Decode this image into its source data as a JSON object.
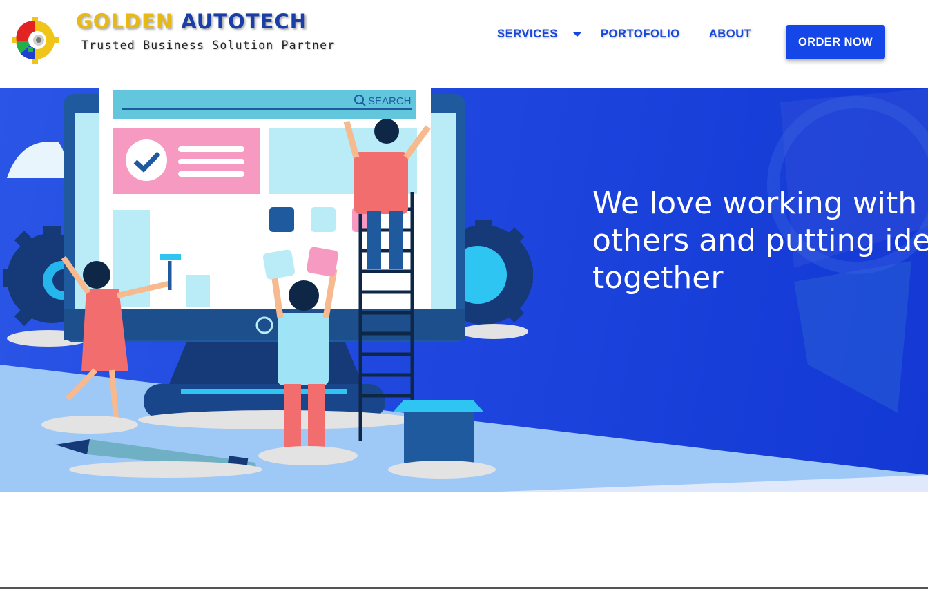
{
  "brand": {
    "name_part1": "GOLDEN",
    "name_part2": "AUTOTECH",
    "tagline": "Trusted Business Solution Partner",
    "logo_icon": "gear-logo-icon"
  },
  "nav": {
    "services": "SERVICES",
    "portfolio": "PORTOFOLIO",
    "about": "ABOUT",
    "order_now": "ORDER NOW",
    "dropdown_icon": "caret-down-icon"
  },
  "hero": {
    "heading_lines": [
      "We love working with",
      "others and putting ideas",
      "together"
    ],
    "search_label": "SEARCH",
    "background_color": "#1d44dd"
  },
  "colors": {
    "accent": "#1446e8",
    "brand_gold": "#e8b912",
    "brand_blue": "#1a3ea8"
  }
}
